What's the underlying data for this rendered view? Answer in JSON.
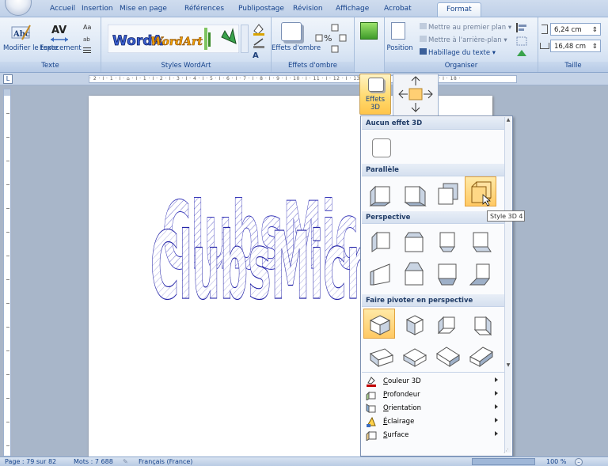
{
  "tabs": [
    {
      "label": "Accueil"
    },
    {
      "label": "Insertion"
    },
    {
      "label": "Mise en page"
    },
    {
      "label": "Références"
    },
    {
      "label": "Publipostage"
    },
    {
      "label": "Révision"
    },
    {
      "label": "Affichage"
    },
    {
      "label": "Acrobat"
    },
    {
      "label": "Format"
    }
  ],
  "ribbon": {
    "texte": {
      "label": "Texte",
      "modifier": "Modifier le texte",
      "espacement": "Espacement"
    },
    "styles_wordart": {
      "label": "Styles WordArt"
    },
    "effets_ombre": {
      "label": "Effets d'ombre",
      "button": "Effets d'ombre"
    },
    "effets3d": {
      "label": "Effets 3D"
    },
    "organiser": {
      "label": "Organiser",
      "position": "Position",
      "mettre_premier_plan": "Mettre au premier plan",
      "mettre_arriere_plan": "Mettre à l'arrière-plan",
      "habillage": "Habillage du texte"
    },
    "taille": {
      "label": "Taille",
      "height": "6,24 cm",
      "width": "16,48 cm"
    }
  },
  "ruler": {
    "h_text": "· 2 · I · 1 · I · ⌂ · I · 1 · I · 2 · I · 3 · I · 4 · I · 5 · I · 6 · I · 7 · I · 8 · I · 9 · I · 10 · I · 11 · I · 12 · I · 13 · I · 14 · I · 15 · I · ⌂ · I · 17 · I · 18 ·"
  },
  "document": {
    "wordart_text": "ClubsMicrosoft"
  },
  "menu": {
    "button": "Effets 3D",
    "sections": {
      "none": "Aucun effet 3D",
      "parallel": "Parallèle",
      "perspective": "Perspective",
      "rotate": "Faire pivoter en perspective"
    },
    "items": [
      {
        "pre": "",
        "key": "C",
        "post": "ouleur 3D",
        "icon": "color-3d-icon"
      },
      {
        "pre": "",
        "key": "P",
        "post": "rofondeur",
        "icon": "depth-icon"
      },
      {
        "pre": "",
        "key": "O",
        "post": "rientation",
        "icon": "direction-icon"
      },
      {
        "pre": "",
        "key": "É",
        "post": "clairage",
        "icon": "lighting-icon"
      },
      {
        "pre": "",
        "key": "S",
        "post": "urface",
        "icon": "surface-icon"
      }
    ],
    "tooltip": "Style 3D 4"
  },
  "status": {
    "page": "Page : 79 sur 82",
    "words": "Mots : 7 688",
    "language": "Français (France)",
    "zoom": "100 %"
  }
}
